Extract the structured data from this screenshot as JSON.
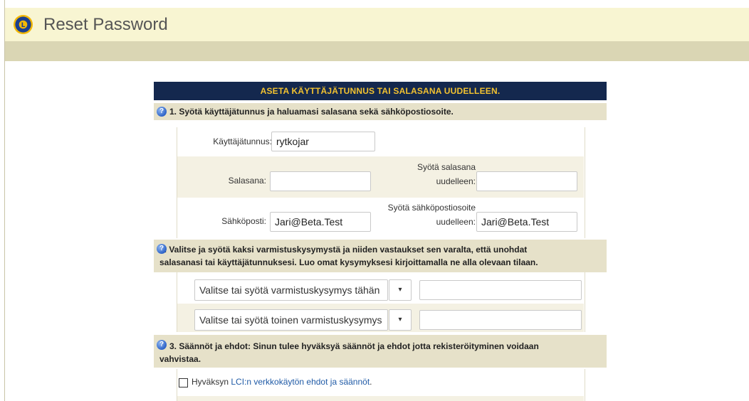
{
  "page": {
    "title": "Reset Password"
  },
  "form": {
    "header": "ASETA KÄYTTÄJÄTUNNUS TAI SALASANA UUDELLEEN.",
    "section1": {
      "heading": "1. Syötä käyttäjätunnus ja haluamasi salasana sekä sähköpostiosoite.",
      "username_label": "Käyttäjätunnus:",
      "username_value": "rytkojar",
      "password_label": "Salasana:",
      "password_value": "",
      "password_confirm_label_1": "Syötä salasana",
      "password_confirm_label_2": "uudelleen:",
      "password_confirm_value": "",
      "email_label": "Sähköposti:",
      "email_value": "Jari@Beta.Test",
      "email_confirm_label_1": "Syötä sähköpostiosoite",
      "email_confirm_label_2": "uudelleen:",
      "email_confirm_value": "Jari@Beta.Test"
    },
    "section2": {
      "heading_line1": "2. Valitse ja syötä kaksi varmistuskysymystä ja niiden vastaukset sen varalta, että unohdat",
      "heading_line2": "salasanasi tai käyttäjätunnuksesi. Luo omat kysymyksesi kirjoittamalla ne alla olevaan tilaan.",
      "question1_value": "Valitse tai syötä varmistuskysymys tähän",
      "question2_value": "Valitse tai syötä toinen varmistuskysymys",
      "answer1_value": "",
      "answer2_value": "",
      "dropdown_glyph": "▾"
    },
    "section3": {
      "heading_line1": "3. Säännöt ja ehdot: Sinun tulee hyväksyä säännöt ja ehdot jotta rekisteröityminen voidaan",
      "heading_line2": "vahvistaa.",
      "accept_prefix": "Hyväksyn ",
      "accept_link": "LCI:n verkkokäytön ehdot ja säännöt",
      "accept_suffix": "."
    },
    "help_glyph": "?"
  },
  "colors": {
    "title_bar": "#f8f5d2",
    "sub_bar": "#dad6b4",
    "form_header_bg": "#14284e",
    "form_header_text": "#f2c230",
    "section_bg": "#e6e1c9",
    "link": "#1f5aa6"
  }
}
